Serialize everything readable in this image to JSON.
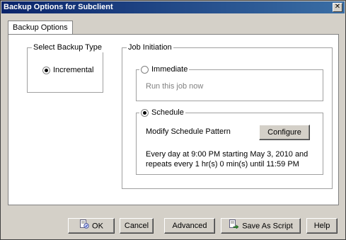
{
  "window": {
    "title": "Backup Options for Subclient",
    "close_glyph": "✕"
  },
  "tabs": [
    {
      "label": "Backup Options"
    }
  ],
  "backup_type": {
    "legend": "Select Backup Type",
    "option_label": "Incremental",
    "selected": true
  },
  "job_initiation": {
    "legend": "Job Initiation",
    "immediate": {
      "label": "Immediate",
      "selected": false,
      "description": "Run this job now"
    },
    "schedule": {
      "label": "Schedule",
      "selected": true,
      "pattern_label": "Modify Schedule Pattern",
      "configure_label": "Configure",
      "summary_line1": "Every day at 9:00 PM  starting May 3, 2010 and",
      "summary_line2": "repeats every 1 hr(s) 0 min(s) until 11:59 PM"
    }
  },
  "footer": {
    "ok_label": "OK",
    "cancel_label": "Cancel",
    "advanced_label": "Advanced",
    "save_script_label": "Save As Script",
    "help_label": "Help"
  },
  "icons": {
    "ok": "ok-document-icon",
    "save_script": "script-arrow-icon"
  }
}
